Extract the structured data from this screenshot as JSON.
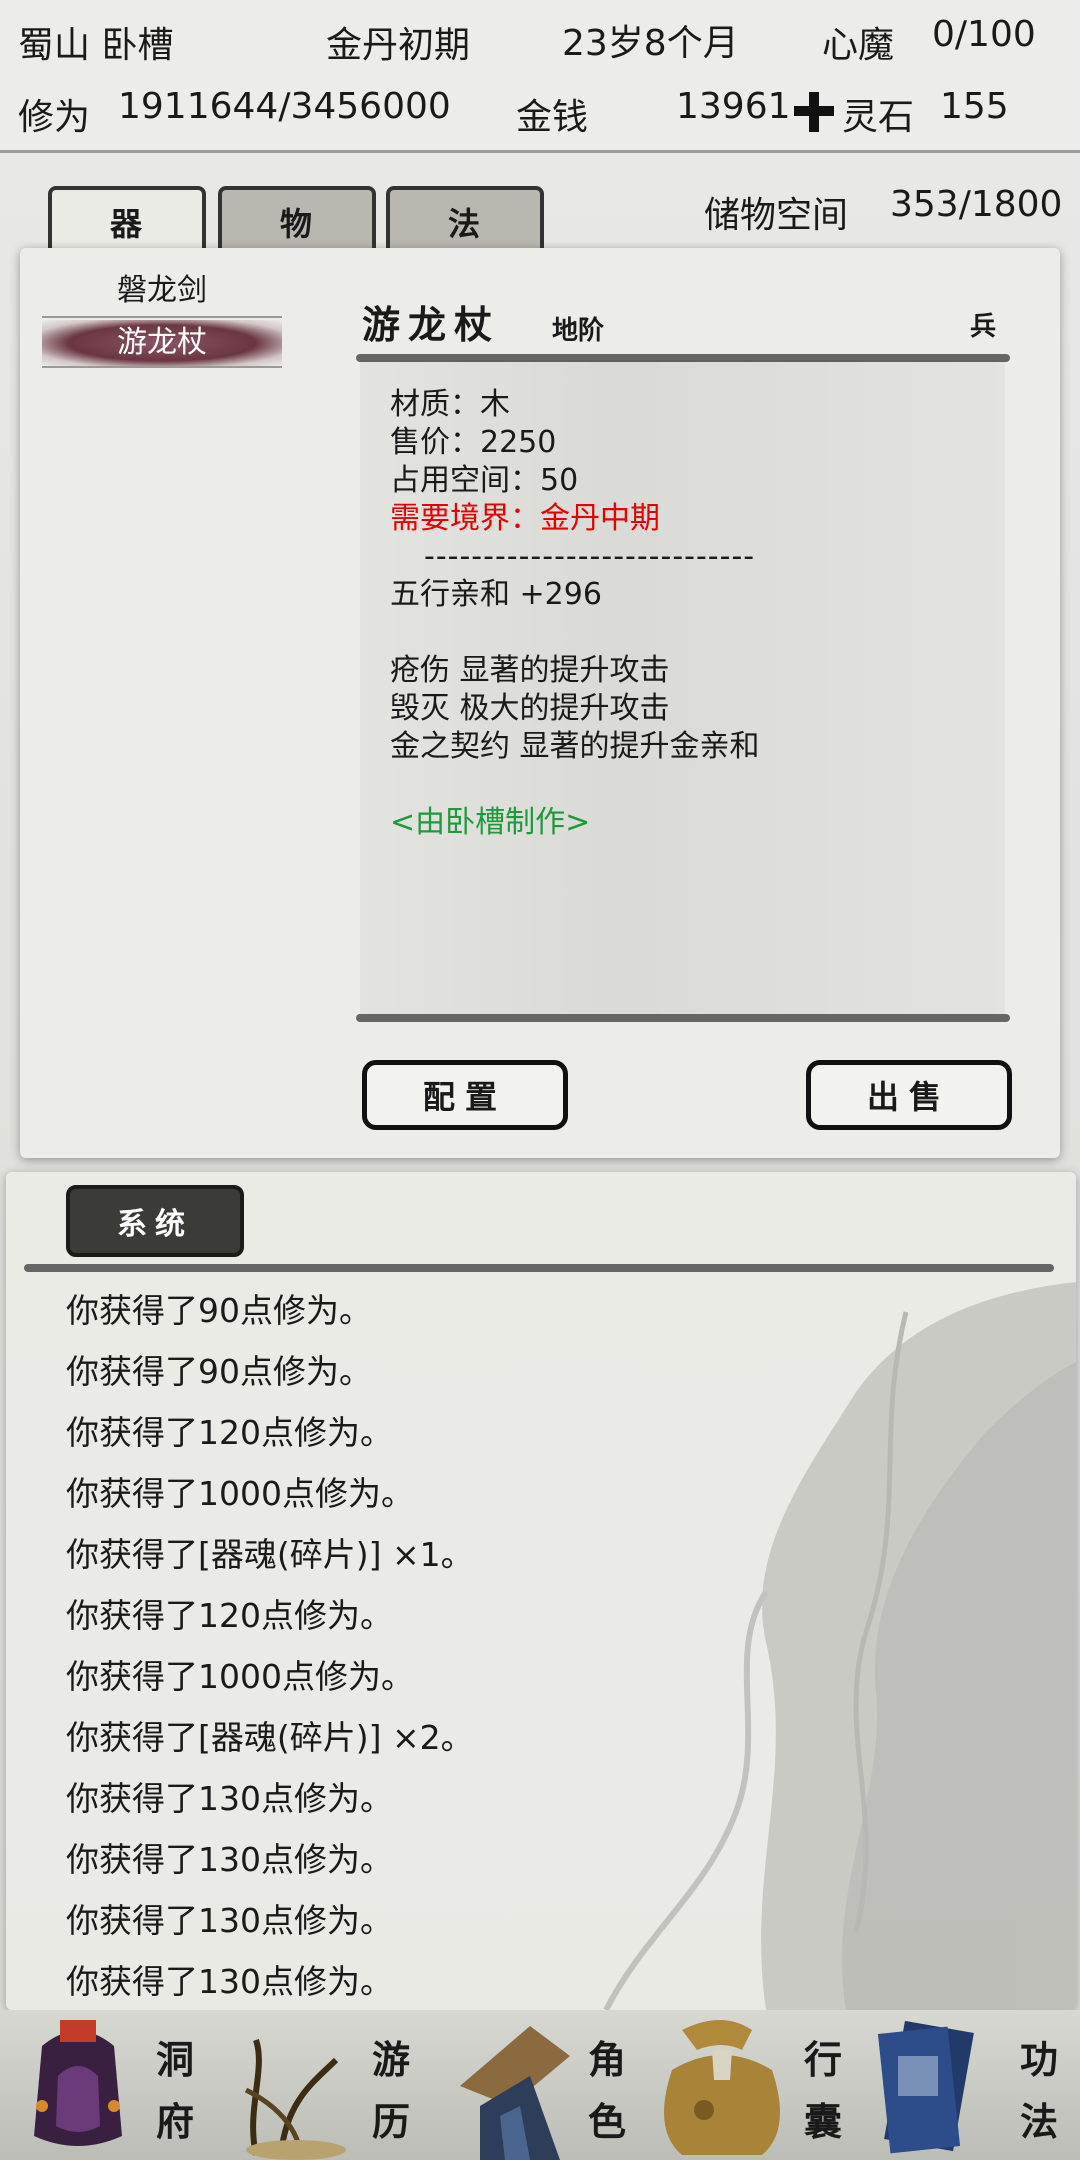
{
  "status": {
    "location": "蜀山 卧槽",
    "realm": "金丹初期",
    "age": "23岁8个月",
    "heart_demon_label": "心魔",
    "heart_demon_value": "0/100",
    "cultivation_label": "修为",
    "cultivation_value": "1911644/3456000",
    "money_label": "金钱",
    "money_value": "13961",
    "spirit_stone_label": "灵石",
    "spirit_stone_value": "155"
  },
  "tabs": [
    {
      "label": "器",
      "active": true
    },
    {
      "label": "物",
      "active": false
    },
    {
      "label": "法",
      "active": false
    }
  ],
  "storage": {
    "label": "储物空间",
    "value": "353/1800"
  },
  "item_list": [
    {
      "name": "磐龙剑",
      "selected": false
    },
    {
      "name": "游龙杖",
      "selected": true
    }
  ],
  "detail": {
    "name": "游龙杖",
    "grade": "地阶",
    "type": "兵",
    "lines": [
      "材质：木",
      "售价：2250",
      "占用空间：50"
    ],
    "requirement": "需要境界：金丹中期",
    "divider": "----------------------------",
    "stat": "五行亲和 +296",
    "effects": [
      "疮伤 显著的提升攻击",
      "毁灭 极大的提升攻击",
      "金之契约 显著的提升金亲和"
    ],
    "maker": "<由卧槽制作>"
  },
  "buttons": {
    "equip": "配置",
    "sell": "出售"
  },
  "log": {
    "tab_label": "系统",
    "lines": [
      "你获得了90点修为。",
      "你获得了90点修为。",
      "你获得了120点修为。",
      "你获得了1000点修为。",
      "你获得了[器魂(碎片)] ×1。",
      "你获得了120点修为。",
      "你获得了1000点修为。",
      "你获得了[器魂(碎片)] ×2。",
      "你获得了130点修为。",
      "你获得了130点修为。",
      "你获得了130点修为。",
      "你获得了130点修为。"
    ]
  },
  "nav": [
    {
      "top": "洞",
      "bottom": "府",
      "icon": "cave-icon"
    },
    {
      "top": "游",
      "bottom": "历",
      "icon": "travel-icon"
    },
    {
      "top": "角",
      "bottom": "色",
      "icon": "character-icon"
    },
    {
      "top": "行",
      "bottom": "囊",
      "icon": "bag-icon"
    },
    {
      "top": "功",
      "bottom": "法",
      "icon": "skill-book-icon"
    }
  ],
  "colors": {
    "requirement": "#e60000",
    "maker": "#1f9a3a",
    "selected_item_bg": "#6b3642"
  }
}
